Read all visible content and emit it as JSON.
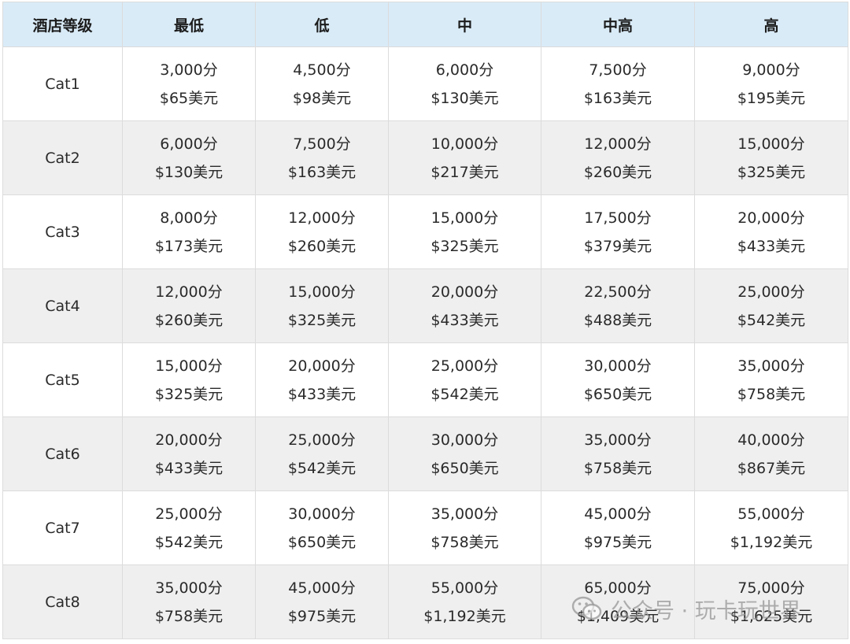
{
  "table": {
    "headers": [
      "酒店等级",
      "最低",
      "低",
      "中",
      "中高",
      "高"
    ],
    "rows": [
      {
        "category": "Cat1",
        "cells": [
          {
            "points": "3,000分",
            "usd": "$65美元"
          },
          {
            "points": "4,500分",
            "usd": "$98美元"
          },
          {
            "points": "6,000分",
            "usd": "$130美元"
          },
          {
            "points": "7,500分",
            "usd": "$163美元"
          },
          {
            "points": "9,000分",
            "usd": "$195美元"
          }
        ]
      },
      {
        "category": "Cat2",
        "cells": [
          {
            "points": "6,000分",
            "usd": "$130美元"
          },
          {
            "points": "7,500分",
            "usd": "$163美元"
          },
          {
            "points": "10,000分",
            "usd": "$217美元"
          },
          {
            "points": "12,000分",
            "usd": "$260美元"
          },
          {
            "points": "15,000分",
            "usd": "$325美元"
          }
        ]
      },
      {
        "category": "Cat3",
        "cells": [
          {
            "points": "8,000分",
            "usd": "$173美元"
          },
          {
            "points": "12,000分",
            "usd": "$260美元"
          },
          {
            "points": "15,000分",
            "usd": "$325美元"
          },
          {
            "points": "17,500分",
            "usd": "$379美元"
          },
          {
            "points": "20,000分",
            "usd": "$433美元"
          }
        ]
      },
      {
        "category": "Cat4",
        "cells": [
          {
            "points": "12,000分",
            "usd": "$260美元"
          },
          {
            "points": "15,000分",
            "usd": "$325美元"
          },
          {
            "points": "20,000分",
            "usd": "$433美元"
          },
          {
            "points": "22,500分",
            "usd": "$488美元"
          },
          {
            "points": "25,000分",
            "usd": "$542美元"
          }
        ]
      },
      {
        "category": "Cat5",
        "cells": [
          {
            "points": "15,000分",
            "usd": "$325美元"
          },
          {
            "points": "20,000分",
            "usd": "$433美元"
          },
          {
            "points": "25,000分",
            "usd": "$542美元"
          },
          {
            "points": "30,000分",
            "usd": "$650美元"
          },
          {
            "points": "35,000分",
            "usd": "$758美元"
          }
        ]
      },
      {
        "category": "Cat6",
        "cells": [
          {
            "points": "20,000分",
            "usd": "$433美元"
          },
          {
            "points": "25,000分",
            "usd": "$542美元"
          },
          {
            "points": "30,000分",
            "usd": "$650美元"
          },
          {
            "points": "35,000分",
            "usd": "$758美元"
          },
          {
            "points": "40,000分",
            "usd": "$867美元"
          }
        ]
      },
      {
        "category": "Cat7",
        "cells": [
          {
            "points": "25,000分",
            "usd": "$542美元"
          },
          {
            "points": "30,000分",
            "usd": "$650美元"
          },
          {
            "points": "35,000分",
            "usd": "$758美元"
          },
          {
            "points": "45,000分",
            "usd": "$975美元"
          },
          {
            "points": "55,000分",
            "usd": "$1,192美元"
          }
        ]
      },
      {
        "category": "Cat8",
        "cells": [
          {
            "points": "35,000分",
            "usd": "$758美元"
          },
          {
            "points": "45,000分",
            "usd": "$975美元"
          },
          {
            "points": "55,000分",
            "usd": "$1,192美元"
          },
          {
            "points": "65,000分",
            "usd": "$1,409美元"
          },
          {
            "points": "75,000分",
            "usd": "$1,625美元"
          }
        ]
      }
    ]
  },
  "watermark": {
    "icon": "wechat-icon",
    "text": "公众号 · 玩卡玩世界"
  }
}
